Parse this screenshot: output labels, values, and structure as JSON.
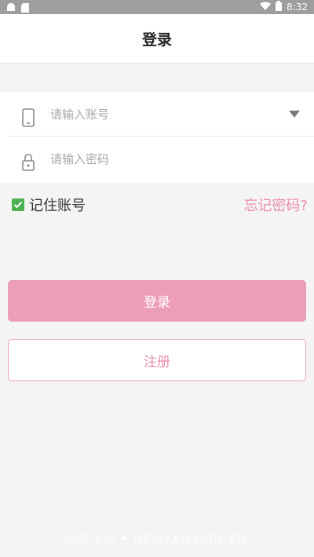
{
  "status_bar": {
    "time": "8:32",
    "bg_color": "#9e9e9e"
  },
  "header": {
    "title": "登录"
  },
  "form": {
    "account": {
      "placeholder": "请输入账号",
      "icon": "phone-icon",
      "has_dropdown": true
    },
    "password": {
      "placeholder": "请输入密码",
      "icon": "lock-icon"
    }
  },
  "remember": {
    "label": "记住账号",
    "checked": true
  },
  "forgot_label": "忘记密码?",
  "buttons": {
    "login_label": "登录",
    "register_label": "注册"
  },
  "watermark": "玩壹下载 • NBWYXH.COM.CN",
  "colors": {
    "accent": "#ec9db7",
    "accent_text": "#e98eab",
    "checkbox": "#4caf50"
  }
}
